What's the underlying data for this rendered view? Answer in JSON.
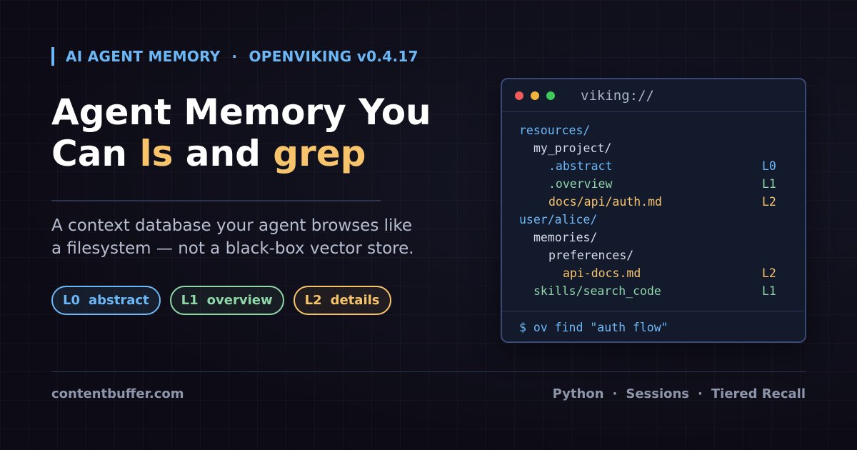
{
  "eyebrow": {
    "left": "AI AGENT MEMORY",
    "separator": "·",
    "right": "OPENVIKING v0.4.17"
  },
  "headline": {
    "line1": "Agent Memory You",
    "line2_prefix": "Can ",
    "line2_highlight1": "ls",
    "line2_middle": " and ",
    "line2_highlight2": "grep"
  },
  "subtitle": {
    "line1": "A context database your agent browses like",
    "line2": "a filesystem — not a black-box vector store."
  },
  "pills": [
    {
      "level": "L0",
      "label": "abstract"
    },
    {
      "level": "L1",
      "label": "overview"
    },
    {
      "level": "L2",
      "label": "details"
    }
  ],
  "terminal": {
    "title": "viking://",
    "tree": [
      {
        "path": "resources/",
        "level": "",
        "color": "blue"
      },
      {
        "path": "my_project/",
        "level": "",
        "color": "white"
      },
      {
        "path": ".abstract",
        "level": "L0",
        "color": "blue"
      },
      {
        "path": ".overview",
        "level": "L1",
        "color": "green"
      },
      {
        "path": "docs/api/auth.md",
        "level": "L2",
        "color": "yellow"
      },
      {
        "path": "user/alice/",
        "level": "",
        "color": "blue"
      },
      {
        "path": "memories/",
        "level": "",
        "color": "white"
      },
      {
        "path": "preferences/",
        "level": "",
        "color": "white"
      },
      {
        "path": "api-docs.md",
        "level": "L2",
        "color": "yellow"
      },
      {
        "path": "skills/search_code",
        "level": "L1",
        "color": "green"
      }
    ],
    "prompt": "$ ov find \"auth flow\""
  },
  "footer": {
    "site": "contentbuffer.com",
    "tags": [
      "Python",
      "Sessions",
      "Tiered Recall"
    ],
    "separator": "·"
  },
  "colors": {
    "accent_blue": "#6cb8f6",
    "accent_green": "#8fd6a8",
    "accent_yellow": "#f7c46c",
    "background": "#0d0c16"
  }
}
